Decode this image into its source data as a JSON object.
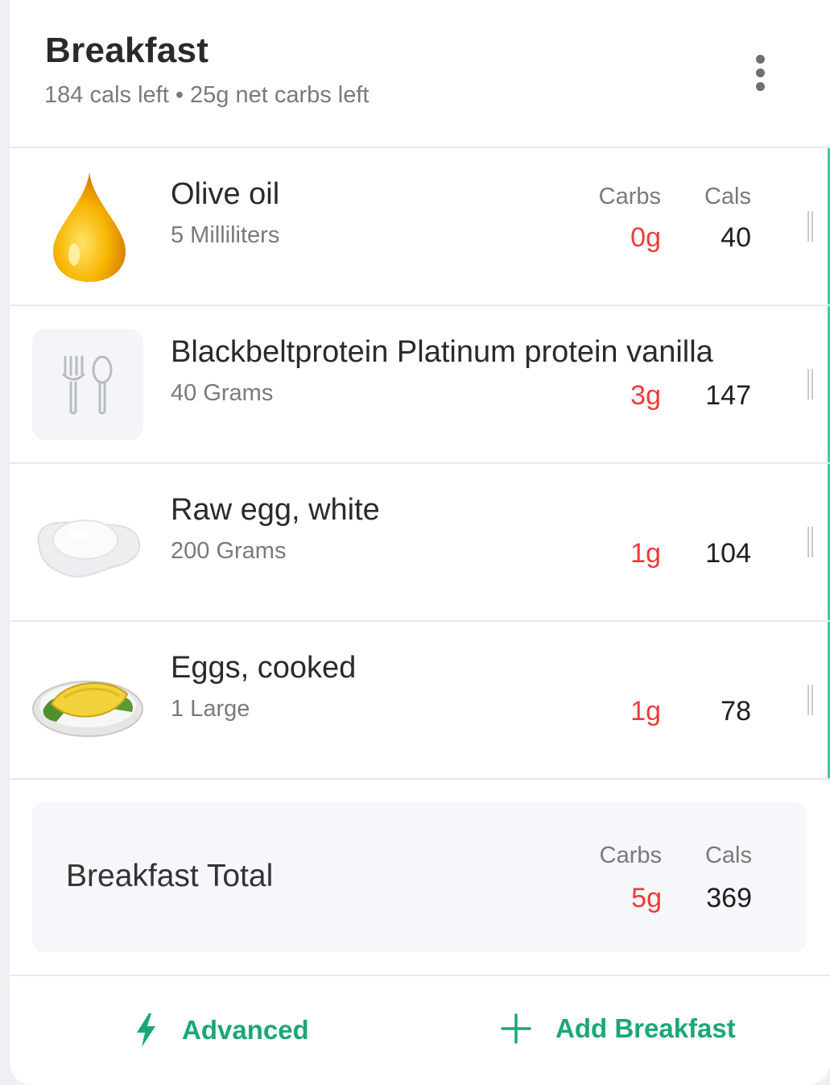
{
  "meal": {
    "title": "Breakfast",
    "subtitle": "184 cals left • 25g net carbs left"
  },
  "columns": {
    "carbs": "Carbs",
    "cals": "Cals"
  },
  "items": [
    {
      "name": "Olive oil",
      "amount": "5 Milliliters",
      "carbs": "0g",
      "cals": "40",
      "icon": "olive-oil-drop-icon"
    },
    {
      "name": "Blackbeltprotein Platinum protein vanilla",
      "amount": "40 Grams",
      "carbs": "3g",
      "cals": "147",
      "icon": "fork-spoon-icon"
    },
    {
      "name": "Raw egg, white",
      "amount": "200 Grams",
      "carbs": "1g",
      "cals": "104",
      "icon": "egg-white-icon"
    },
    {
      "name": "Eggs, cooked",
      "amount": "1 Large",
      "carbs": "1g",
      "cals": "78",
      "icon": "omelette-icon"
    }
  ],
  "total": {
    "label": "Breakfast Total",
    "carbs": "5g",
    "cals": "369"
  },
  "footer": {
    "advanced": "Advanced",
    "add": "Add Breakfast"
  },
  "colors": {
    "accent": "#1aa874",
    "carbs": "#ef3b3b",
    "rowAccent": "#3ec8a9"
  }
}
